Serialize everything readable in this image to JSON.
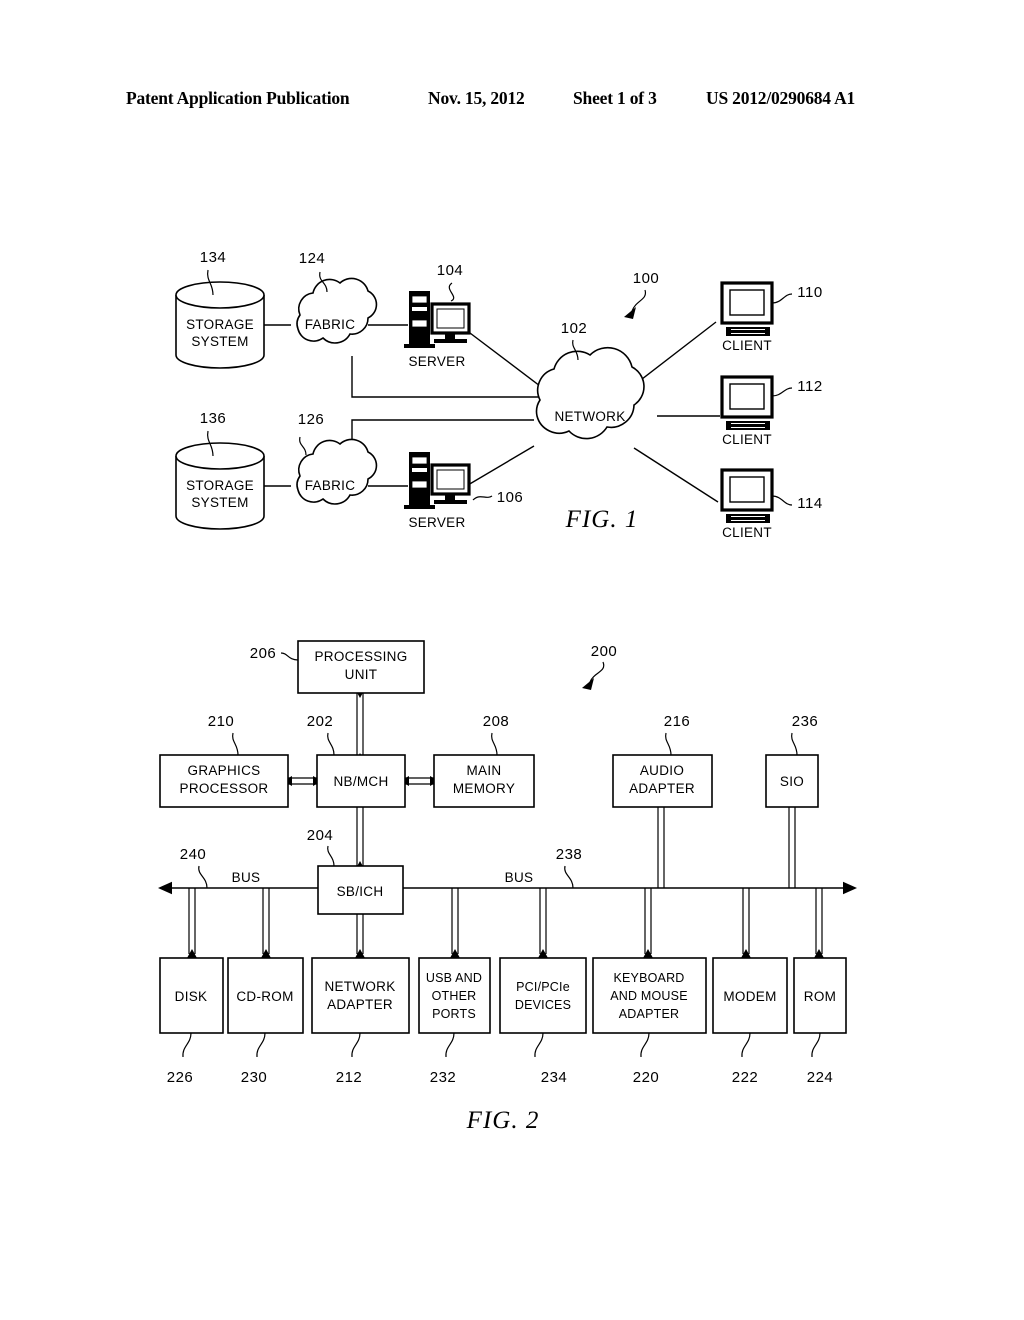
{
  "header": {
    "title": "Patent Application Publication",
    "date": "Nov. 15, 2012",
    "sheet": "Sheet 1 of 3",
    "publication_number": "US 2012/0290684 A1"
  },
  "figure1": {
    "caption": "FIG. 1",
    "system_ref": "100",
    "nodes": {
      "storage_system_top": {
        "label_line1": "STORAGE",
        "label_line2": "SYSTEM",
        "ref": "134"
      },
      "storage_system_bottom": {
        "label_line1": "STORAGE",
        "label_line2": "SYSTEM",
        "ref": "136"
      },
      "fabric_top": {
        "label": "FABRIC",
        "ref": "124"
      },
      "fabric_bottom": {
        "label": "FABRIC",
        "ref": "126"
      },
      "server_top": {
        "label": "SERVER",
        "ref": "104"
      },
      "server_bottom": {
        "label": "SERVER",
        "ref": "106"
      },
      "network": {
        "label": "NETWORK",
        "ref": "102"
      },
      "client_1": {
        "label": "CLIENT",
        "ref": "110"
      },
      "client_2": {
        "label": "CLIENT",
        "ref": "112"
      },
      "client_3": {
        "label": "CLIENT",
        "ref": "114"
      }
    }
  },
  "figure2": {
    "caption": "FIG. 2",
    "system_ref": "200",
    "bus_left_label": "BUS",
    "bus_right_label": "BUS",
    "bus_left_ref": "240",
    "bus_right_ref": "238",
    "blocks": {
      "processing_unit": {
        "label_line1": "PROCESSING",
        "label_line2": "UNIT",
        "ref": "206"
      },
      "graphics_processor": {
        "label_line1": "GRAPHICS",
        "label_line2": "PROCESSOR",
        "ref": "210"
      },
      "nb_mch": {
        "label_line1": "NB/MCH",
        "label_line2": "",
        "ref": "202"
      },
      "main_memory": {
        "label_line1": "MAIN",
        "label_line2": "MEMORY",
        "ref": "208"
      },
      "audio_adapter": {
        "label_line1": "AUDIO",
        "label_line2": "ADAPTER",
        "ref": "216"
      },
      "sio": {
        "label_line1": "SIO",
        "label_line2": "",
        "ref": "236"
      },
      "sb_ich": {
        "label_line1": "SB/ICH",
        "label_line2": "",
        "ref": "204"
      },
      "disk": {
        "label_line1": "DISK",
        "label_line2": "",
        "label_line3": "",
        "ref": "226"
      },
      "cd_rom": {
        "label_line1": "CD-ROM",
        "label_line2": "",
        "label_line3": "",
        "ref": "230"
      },
      "network_adapter": {
        "label_line1": "NETWORK",
        "label_line2": "ADAPTER",
        "label_line3": "",
        "ref": "212"
      },
      "usb_ports": {
        "label_line1": "USB AND",
        "label_line2": "OTHER",
        "label_line3": "PORTS",
        "ref": "232"
      },
      "pci_devices": {
        "label_line1": "PCI/PCIe",
        "label_line2": "DEVICES",
        "label_line3": "",
        "ref": "234"
      },
      "keyboard_mouse_adapter": {
        "label_line1": "KEYBOARD",
        "label_line2": "AND MOUSE",
        "label_line3": "ADAPTER",
        "ref": "220"
      },
      "modem": {
        "label_line1": "MODEM",
        "label_line2": "",
        "label_line3": "",
        "ref": "222"
      },
      "rom": {
        "label_line1": "ROM",
        "label_line2": "",
        "label_line3": "",
        "ref": "224"
      }
    }
  },
  "colors": {
    "ink": "#000000",
    "paper": "#ffffff"
  }
}
